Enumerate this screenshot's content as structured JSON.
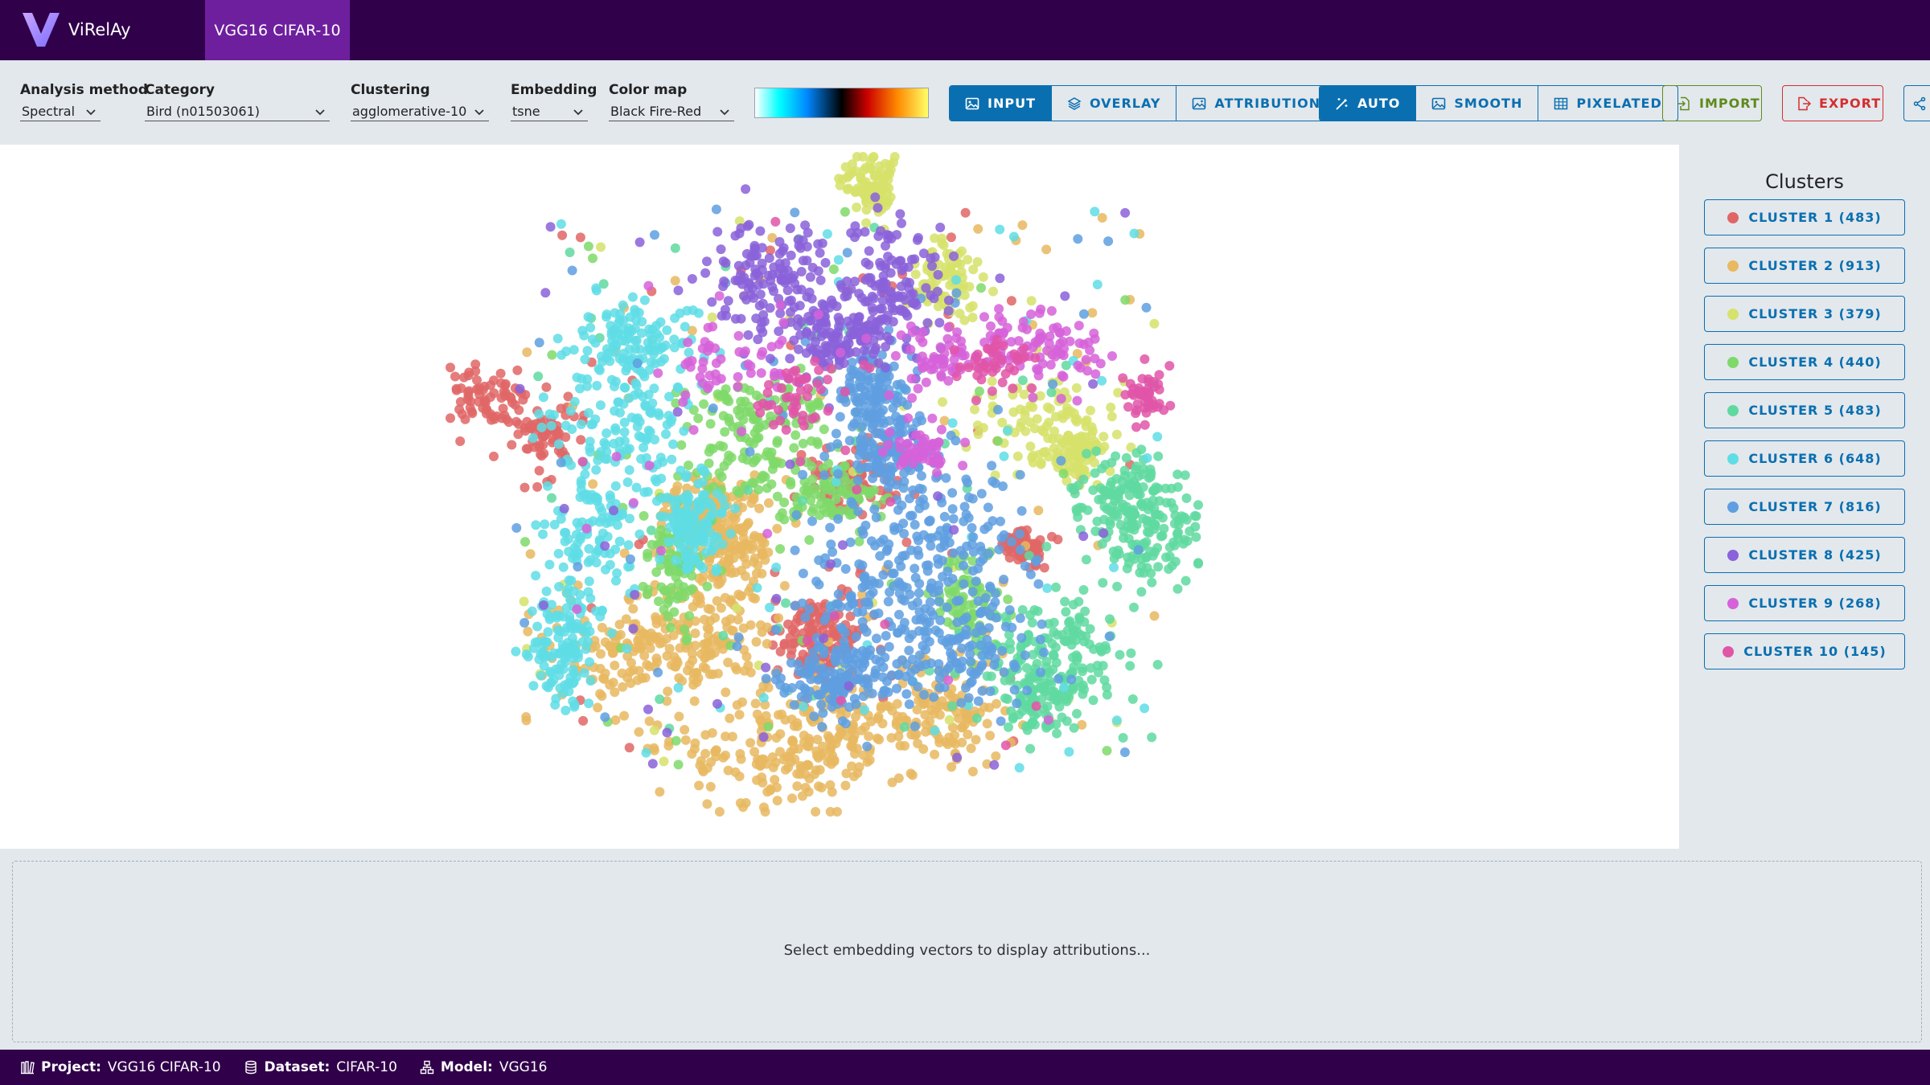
{
  "app": {
    "name": "ViRelAy",
    "project_tab": "VGG16 CIFAR-10"
  },
  "toolbar": {
    "analysis_method": {
      "label": "Analysis method",
      "value": "Spectral"
    },
    "category": {
      "label": "Category",
      "value": "Bird (n01503061)"
    },
    "clustering": {
      "label": "Clustering",
      "value": "agglomerative-10"
    },
    "embedding": {
      "label": "Embedding",
      "value": "tsne"
    },
    "color_map": {
      "label": "Color map",
      "value": "Black Fire-Red"
    },
    "image_mode": [
      {
        "label": "INPUT",
        "icon": "image-icon",
        "active": true
      },
      {
        "label": "OVERLAY",
        "icon": "layers-icon",
        "active": false
      },
      {
        "label": "ATTRIBUTION",
        "icon": "attribution-icon",
        "active": false
      }
    ],
    "interpolation": [
      {
        "label": "AUTO",
        "icon": "magic-wand-icon",
        "active": true
      },
      {
        "label": "SMOOTH",
        "icon": "image-smooth-icon",
        "active": false
      },
      {
        "label": "PIXELATED",
        "icon": "grid-icon",
        "active": false
      }
    ],
    "import_label": "IMPORT",
    "export_label": "EXPORT"
  },
  "clusters": {
    "title": "Clusters",
    "items": [
      {
        "label": "CLUSTER 1 (483)",
        "color": "#e06666"
      },
      {
        "label": "CLUSTER 2 (913)",
        "color": "#e8b960"
      },
      {
        "label": "CLUSTER 3 (379)",
        "color": "#d6e26a"
      },
      {
        "label": "CLUSTER 4 (440)",
        "color": "#7fd96a"
      },
      {
        "label": "CLUSTER 5 (483)",
        "color": "#5fd9a0"
      },
      {
        "label": "CLUSTER 6 (648)",
        "color": "#5fdde5"
      },
      {
        "label": "CLUSTER 7 (816)",
        "color": "#5f9fe0"
      },
      {
        "label": "CLUSTER 8 (425)",
        "color": "#8a62d9"
      },
      {
        "label": "CLUSTER 9 (268)",
        "color": "#d662d9"
      },
      {
        "label": "CLUSTER 10 (145)",
        "color": "#e055a8"
      }
    ]
  },
  "attribution": {
    "message": "Select embedding vectors to display attributions..."
  },
  "statusbar": {
    "project": {
      "key": "Project:",
      "value": "VGG16 CIFAR-10"
    },
    "dataset": {
      "key": "Dataset:",
      "value": "CIFAR-10"
    },
    "model": {
      "key": "Model:",
      "value": "VGG16"
    }
  },
  "chart_data": {
    "type": "scatter",
    "title": "",
    "xlabel": "",
    "ylabel": "",
    "grid": false,
    "legend": "none",
    "note": "t-SNE embedding; no axes printed",
    "series": [
      {
        "color": "#e06666",
        "n": 483
      },
      {
        "color": "#e8b960",
        "n": 913
      },
      {
        "color": "#d6e26a",
        "n": 379
      },
      {
        "color": "#7fd96a",
        "n": 440
      },
      {
        "color": "#5fd9a0",
        "n": 483
      },
      {
        "color": "#5fdde5",
        "n": 648
      },
      {
        "color": "#5f9fe0",
        "n": 816
      },
      {
        "color": "#8a62d9",
        "n": 425
      },
      {
        "color": "#d662d9",
        "n": 268
      },
      {
        "color": "#e055a8",
        "n": 145
      }
    ]
  }
}
